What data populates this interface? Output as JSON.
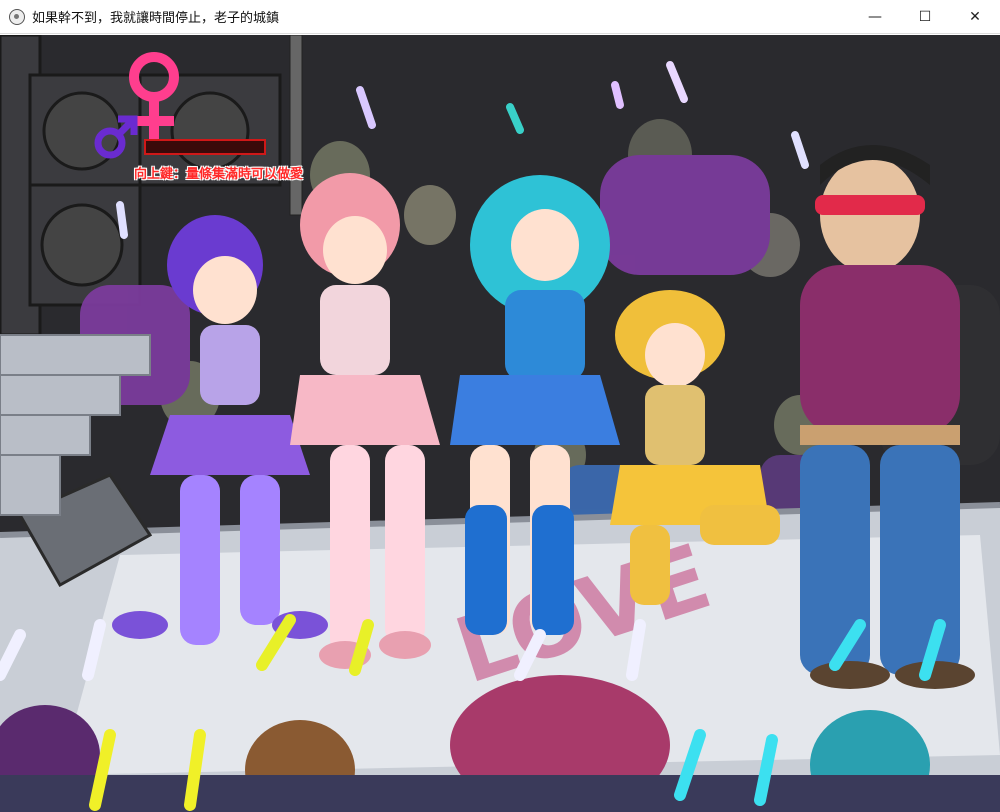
{
  "window": {
    "title": "如果幹不到，我就讓時間停止，老子的城鎮",
    "minimize_symbol": "—",
    "maximize_symbol": "☐",
    "close_symbol": "✕"
  },
  "hud": {
    "female_icon": "female-symbol-icon",
    "male_icon": "male-symbol-icon",
    "lust_gauge_level": 0,
    "hint": "向上鍵：量條集滿時可以做愛"
  },
  "scene": {
    "stage_text": "LOVE",
    "accent_colors": {
      "female_symbol": "#ff3e8e",
      "male_symbol": "#6a2bd0",
      "hint_text": "#ff2a2a",
      "gauge_border": "#d01818"
    }
  }
}
